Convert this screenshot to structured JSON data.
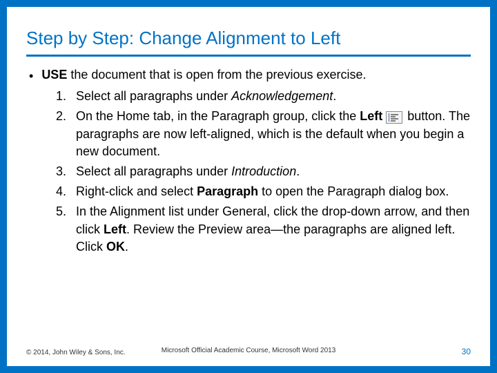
{
  "title": "Step by Step: Change Alignment to Left",
  "intro_prefix_bold": "USE",
  "intro_rest": " the document that is open from the previous exercise.",
  "steps": [
    {
      "num": "1.",
      "runs": [
        {
          "t": "Select all paragraphs under "
        },
        {
          "t": "Acknowledgement",
          "i": true
        },
        {
          "t": "."
        }
      ]
    },
    {
      "num": "2.",
      "runs": [
        {
          "t": "On the Home tab, in the Paragraph group, click the "
        },
        {
          "t": "Left",
          "b": true
        },
        {
          "t": " "
        },
        {
          "icon": "align-left"
        },
        {
          "t": " button. The paragraphs are now left-aligned, which is the default when you begin a new document."
        }
      ]
    },
    {
      "num": "3.",
      "runs": [
        {
          "t": "Select all paragraphs under "
        },
        {
          "t": "Introduction",
          "i": true
        },
        {
          "t": "."
        }
      ]
    },
    {
      "num": "4.",
      "runs": [
        {
          "t": "Right-click and select "
        },
        {
          "t": "Paragraph",
          "b": true
        },
        {
          "t": " to open the Paragraph dialog box."
        }
      ]
    },
    {
      "num": "5.",
      "runs": [
        {
          "t": "In the Alignment list under General, click the drop-down arrow, and then click "
        },
        {
          "t": "Left",
          "b": true
        },
        {
          "t": ". Review the Preview area—the paragraphs are aligned left. Click "
        },
        {
          "t": "OK",
          "b": true
        },
        {
          "t": "."
        }
      ]
    }
  ],
  "footer": {
    "left": "© 2014, John Wiley & Sons, Inc.",
    "center": "Microsoft Official Academic Course, Microsoft Word 2013",
    "right": "30"
  }
}
